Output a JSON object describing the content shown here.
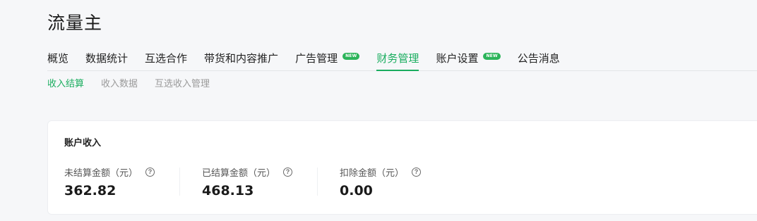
{
  "page": {
    "title": "流量主"
  },
  "main_tabs": [
    {
      "label": "概览"
    },
    {
      "label": "数据统计"
    },
    {
      "label": "互选合作"
    },
    {
      "label": "带货和内容推广"
    },
    {
      "label": "广告管理",
      "badge": "NEW"
    },
    {
      "label": "财务管理",
      "active": true
    },
    {
      "label": "账户设置",
      "badge": "NEW"
    },
    {
      "label": "公告消息"
    }
  ],
  "sub_tabs": [
    {
      "label": "收入结算",
      "active": true
    },
    {
      "label": "收入数据"
    },
    {
      "label": "互选收入管理"
    }
  ],
  "income_card": {
    "title": "账户收入",
    "stats": [
      {
        "label": "未结算金额（元）",
        "value": "362.82"
      },
      {
        "label": "已结算金额（元）",
        "value": "468.13"
      },
      {
        "label": "扣除金额（元）",
        "value": "0.00"
      }
    ]
  },
  "colors": {
    "accent": "#1aad5f",
    "badge": "#2cb45a",
    "background": "#f6f7f9"
  },
  "icons": {
    "help": "question-circle-icon"
  }
}
